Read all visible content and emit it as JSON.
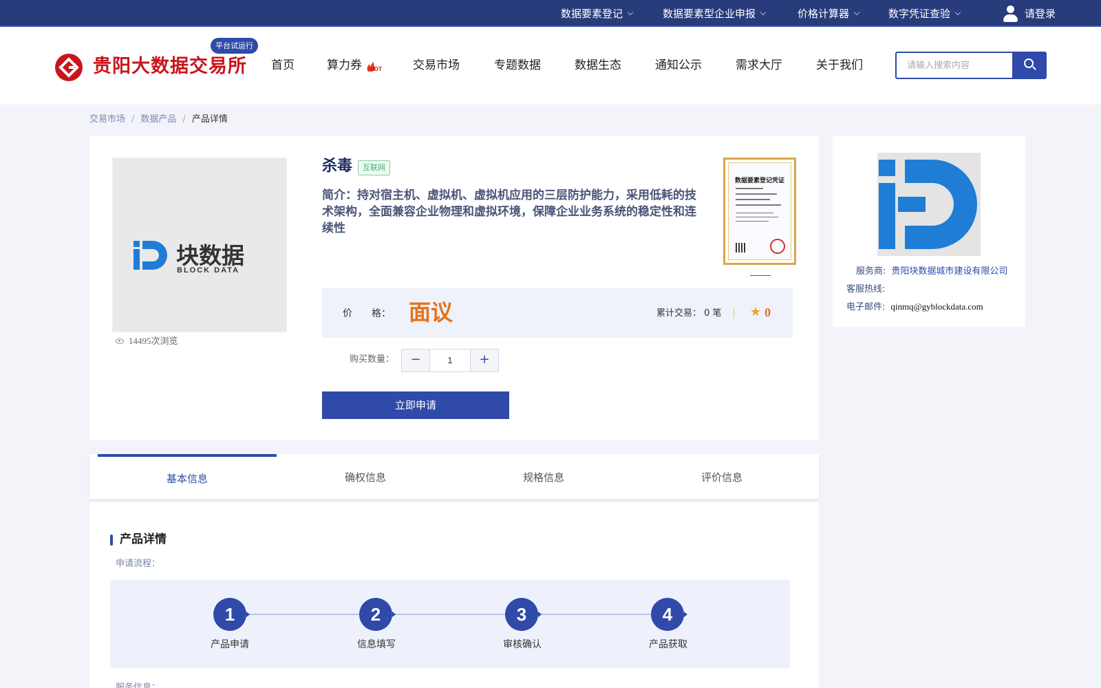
{
  "topbar": {
    "items": [
      {
        "label": "数据要素登记"
      },
      {
        "label": "数据要素型企业申报"
      },
      {
        "label": "价格计算器"
      },
      {
        "label": "数字凭证查验"
      }
    ],
    "login_label": "请登录"
  },
  "header": {
    "site_title": "贵阳大数据交易所",
    "trial_badge": "平台试运行",
    "nav": [
      {
        "label": "首页"
      },
      {
        "label": "算力券"
      },
      {
        "label": "交易市场"
      },
      {
        "label": "专题数据"
      },
      {
        "label": "数据生态"
      },
      {
        "label": "通知公示"
      },
      {
        "label": "需求大厅"
      },
      {
        "label": "关于我们"
      }
    ],
    "hot_label": "HOT",
    "search_placeholder": "请输入搜索内容"
  },
  "breadcrumb": [
    "交易市场",
    "数据产品",
    "产品详情"
  ],
  "product": {
    "name": "杀毒",
    "tag": "互联网",
    "intro": "简介：持对宿主机、虚拟机、虚拟机应用的三层防护能力，采用低耗的技术架构，全面兼容企业物理和虚拟环境，保障企业业务系统的稳定性和连续性",
    "image_brand": "块数据",
    "image_brand_sub": "BLOCK DATA",
    "views": "14495次浏览",
    "certificate_title": "数据要素登记凭证",
    "price_label": "价　　格：",
    "price_value": "面议",
    "trade_label": "累计交易：",
    "trade_count": "0 笔",
    "rating": "0",
    "qty_label": "购买数量：",
    "qty_value": "1",
    "apply_label": "立即申请"
  },
  "provider": {
    "service_label": "服务商:",
    "service_value": "贵阳块数据城市建设有限公司",
    "hotline_label": "客服热线:",
    "hotline_value": "",
    "email_label": "电子邮件:",
    "email_value": "qinmq@gyblockdata.com"
  },
  "tabs": [
    {
      "label": "基本信息",
      "active": true
    },
    {
      "label": "确权信息"
    },
    {
      "label": "规格信息"
    },
    {
      "label": "评价信息"
    }
  ],
  "details": {
    "section_title": "产品详情",
    "flow_label": "申请流程：",
    "steps": [
      {
        "num": "1",
        "label": "产品申请"
      },
      {
        "num": "2",
        "label": "信息填写"
      },
      {
        "num": "3",
        "label": "审核确认"
      },
      {
        "num": "4",
        "label": "产品获取"
      }
    ],
    "service_info_label": "服务信息："
  },
  "colors": {
    "primary": "#2f4aa8",
    "topbar": "#283b7a",
    "brand_red": "#c8161d",
    "price_orange": "#e4731c",
    "block_blue": "#1f7dd6"
  }
}
